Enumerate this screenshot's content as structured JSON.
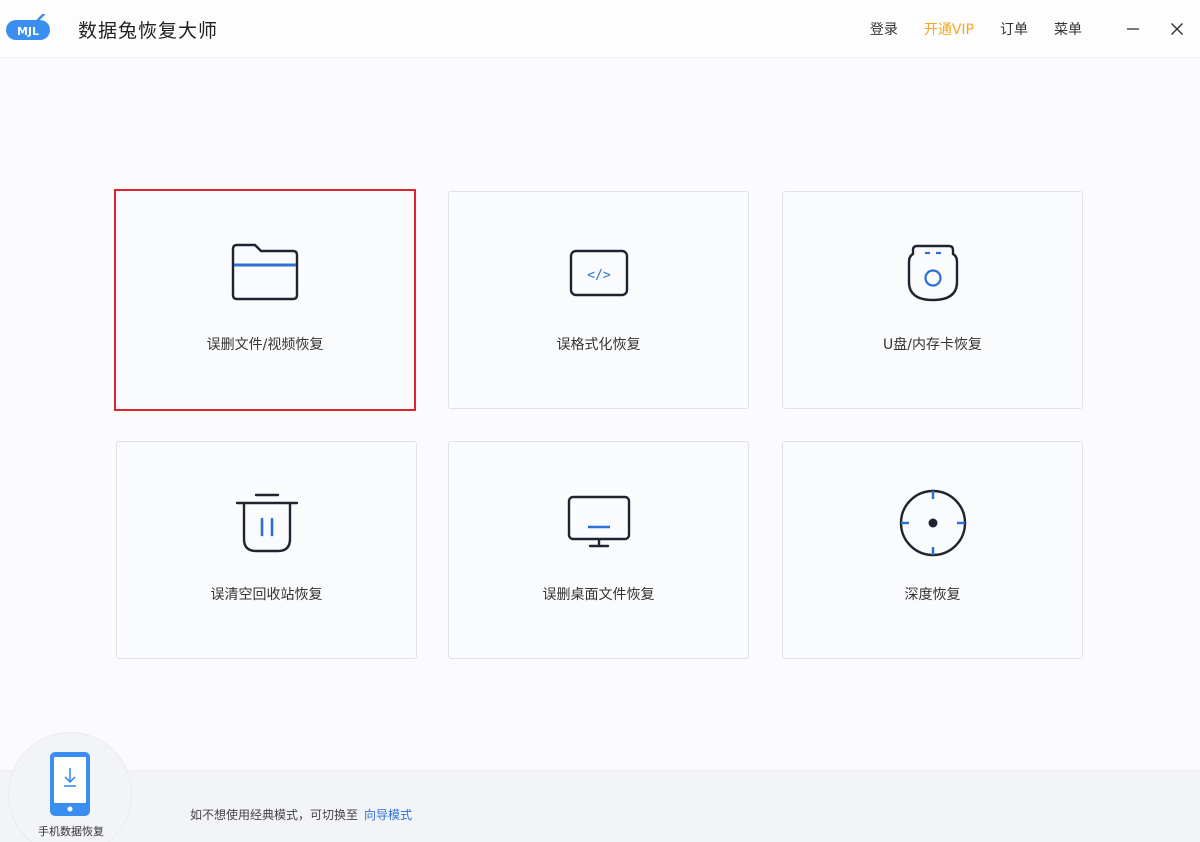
{
  "app": {
    "title": "数据兔恢复大师",
    "logo_text": "MJL"
  },
  "nav": {
    "login": "登录",
    "vip": "开通VIP",
    "orders": "订单",
    "menu": "菜单"
  },
  "colors": {
    "accent": "#2c6fd6",
    "vip": "#f5a623",
    "selected_border": "#d9252b",
    "icon_stroke": "#1f2430"
  },
  "cards": [
    {
      "label": "误删文件/视频恢复",
      "icon": "folder-icon",
      "selected": true
    },
    {
      "label": "误格式化恢复",
      "icon": "code-window-icon",
      "selected": false
    },
    {
      "label": "U盘/内存卡恢复",
      "icon": "usb-drive-icon",
      "selected": false
    },
    {
      "label": "误清空回收站恢复",
      "icon": "trash-bin-icon",
      "selected": false
    },
    {
      "label": "误删桌面文件恢复",
      "icon": "monitor-icon",
      "selected": false
    },
    {
      "label": "深度恢复",
      "icon": "crosshair-icon",
      "selected": false
    }
  ],
  "footer": {
    "mobile_label": "手机数据恢复",
    "hint_text": "如不想使用经典模式，可切换至",
    "hint_link": "向导模式"
  }
}
